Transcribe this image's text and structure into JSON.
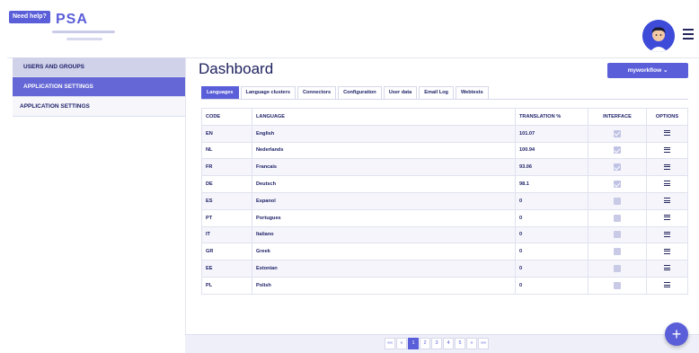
{
  "header": {
    "help_label": "Need help?",
    "logo_text": "PSA",
    "user_avatar": "avatar-icon",
    "menu_icon": "hamburger-icon"
  },
  "sidebar": {
    "items": [
      {
        "label": "USERS AND GROUPS"
      },
      {
        "label": "APPLICATION SETTINGS"
      },
      {
        "label": "APPLICATION SETTINGS"
      }
    ]
  },
  "main": {
    "title": "Dashboard",
    "workflow_button": "myworkflow ⌄",
    "tabs": [
      "Languages",
      "Language clusters",
      "Connectors",
      "Configuration",
      "User data",
      "Email Log",
      "Webtests"
    ],
    "active_tab": "Languages"
  },
  "table": {
    "headers": [
      "CODE",
      "LANGUAGE",
      "TRANSLATION %",
      "INTERFACE",
      "OPTIONS"
    ],
    "rows": [
      {
        "code": "EN",
        "language": "English",
        "translation": "101.07",
        "interface": true
      },
      {
        "code": "NL",
        "language": "Nederlands",
        "translation": "100.94",
        "interface": true
      },
      {
        "code": "FR",
        "language": "Francais",
        "translation": "93.06",
        "interface": true
      },
      {
        "code": "DE",
        "language": "Deutsch",
        "translation": "98.1",
        "interface": true
      },
      {
        "code": "ES",
        "language": "Espanol",
        "translation": "0",
        "interface": false
      },
      {
        "code": "PT",
        "language": "Portugues",
        "translation": "0",
        "interface": false
      },
      {
        "code": "IT",
        "language": "Italiano",
        "translation": "0",
        "interface": false
      },
      {
        "code": "GR",
        "language": "Greek",
        "translation": "0",
        "interface": false
      },
      {
        "code": "EE",
        "language": "Estonian",
        "translation": "0",
        "interface": false
      },
      {
        "code": "PL",
        "language": "Polish",
        "translation": "0",
        "interface": false
      }
    ]
  },
  "pagination": {
    "first": "««",
    "prev": "«",
    "pages": [
      "1",
      "2",
      "3",
      "4",
      "5"
    ],
    "current": "1",
    "next": "»",
    "last": "»»"
  },
  "fab": {
    "label": "+"
  },
  "colors": {
    "accent": "#5a5ed8",
    "text": "#1c1f66"
  }
}
